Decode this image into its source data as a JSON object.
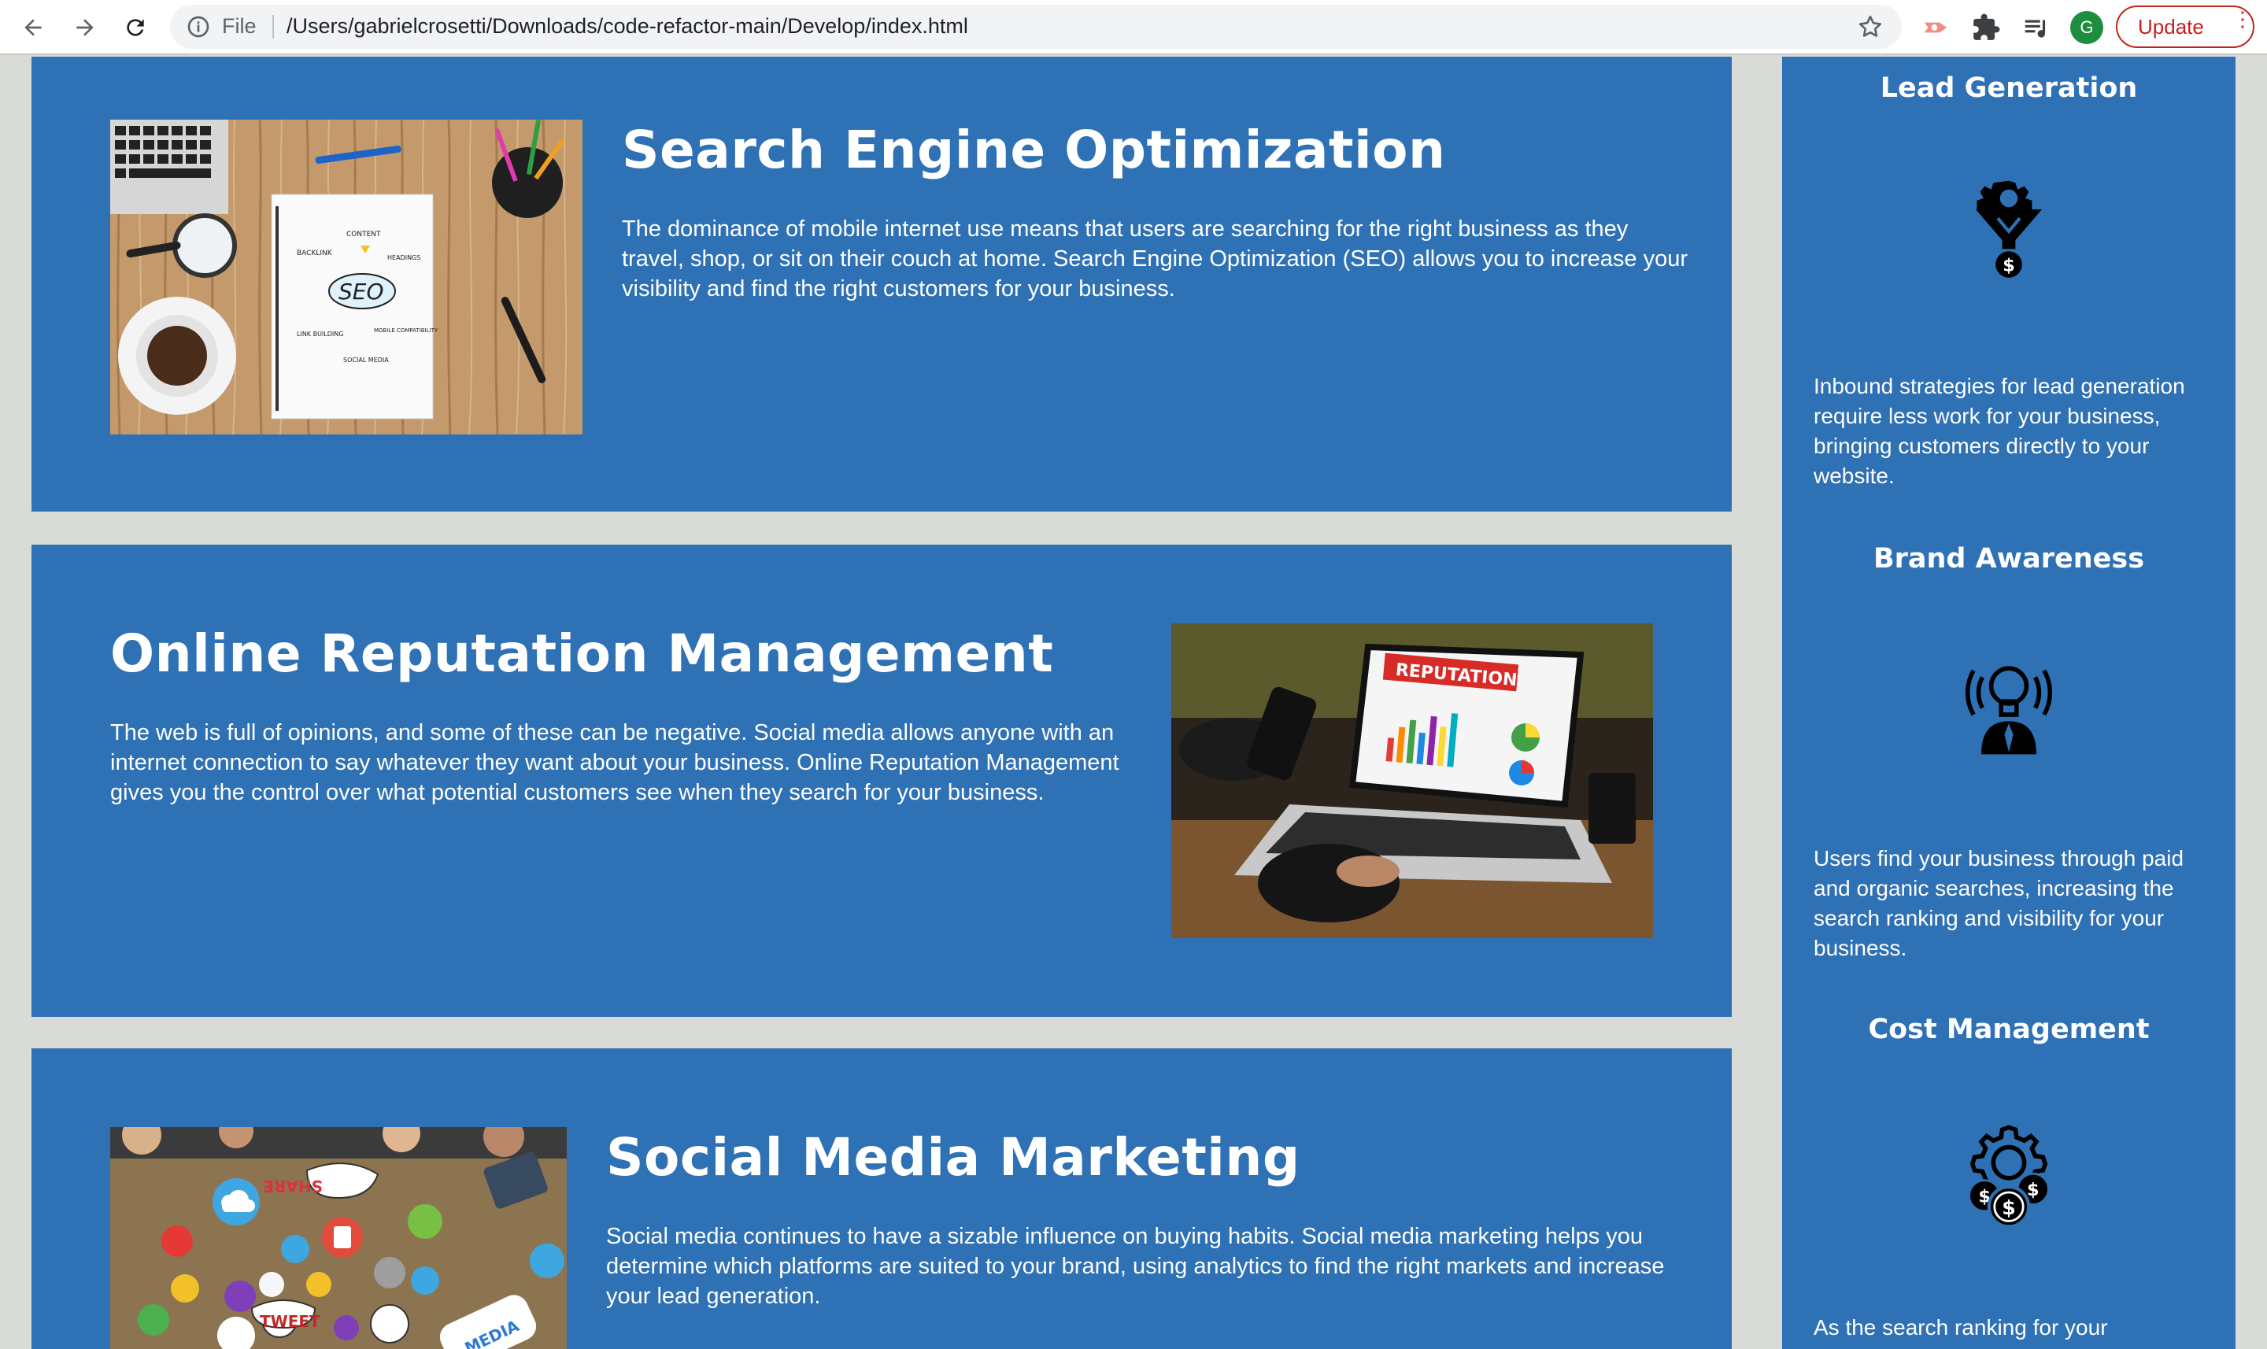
{
  "browser": {
    "back_icon": "arrow-left-icon",
    "forward_icon": "arrow-right-icon",
    "reload_icon": "reload-icon",
    "scheme": "File",
    "url": "/Users/gabrielcrosetti/Downloads/code-refactor-main/Develop/index.html",
    "profile_initial": "G",
    "update_label": "Update"
  },
  "services": [
    {
      "title": "Search Engine Optimization",
      "text": "The dominance of mobile internet use means that users are searching for the right business as they travel, shop, or sit on their couch at home. Search Engine Optimization (SEO) allows you to increase your visibility and find the right customers for your business.",
      "image": {
        "labels": [
          "CONTENT",
          "BACKLINK",
          "HEADINGS",
          "SEO",
          "LINK BUILDING",
          "MOBILE COMPATIBILITY",
          "SOCIAL MEDIA"
        ]
      }
    },
    {
      "title": "Online Reputation Management",
      "text": "The web is full of opinions, and some of these can be negative. Social media allows anyone with an internet connection to say whatever they want about your business. Online Reputation Management gives you the control over what potential customers see when they search for your business.",
      "image": {
        "labels": [
          "REPUTATION"
        ]
      }
    },
    {
      "title": "Social Media Marketing",
      "text": "Social media continues to have a sizable influence on buying habits. Social media marketing helps you determine which platforms are suited to your brand, using analytics to find the right markets and increase your lead generation.",
      "image": {
        "labels": [
          "SHARE",
          "TWEET",
          "MEDIA"
        ]
      }
    }
  ],
  "benefits": [
    {
      "title": "Lead Generation",
      "icon": "funnel-dollar-icon",
      "text": "Inbound strategies for lead generation require less work for your business, bringing customers directly to your website."
    },
    {
      "title": "Brand Awareness",
      "icon": "lightbulb-broadcast-icon",
      "text": "Users find your business through paid and organic searches, increasing the search ranking and visibility for your business."
    },
    {
      "title": "Cost Management",
      "icon": "gear-dollar-icon",
      "text": "As the search ranking for your"
    }
  ],
  "colors": {
    "page_bg": "#d9dcd6",
    "panel_blue": "#2f71b5",
    "update_red": "#c5221f"
  }
}
